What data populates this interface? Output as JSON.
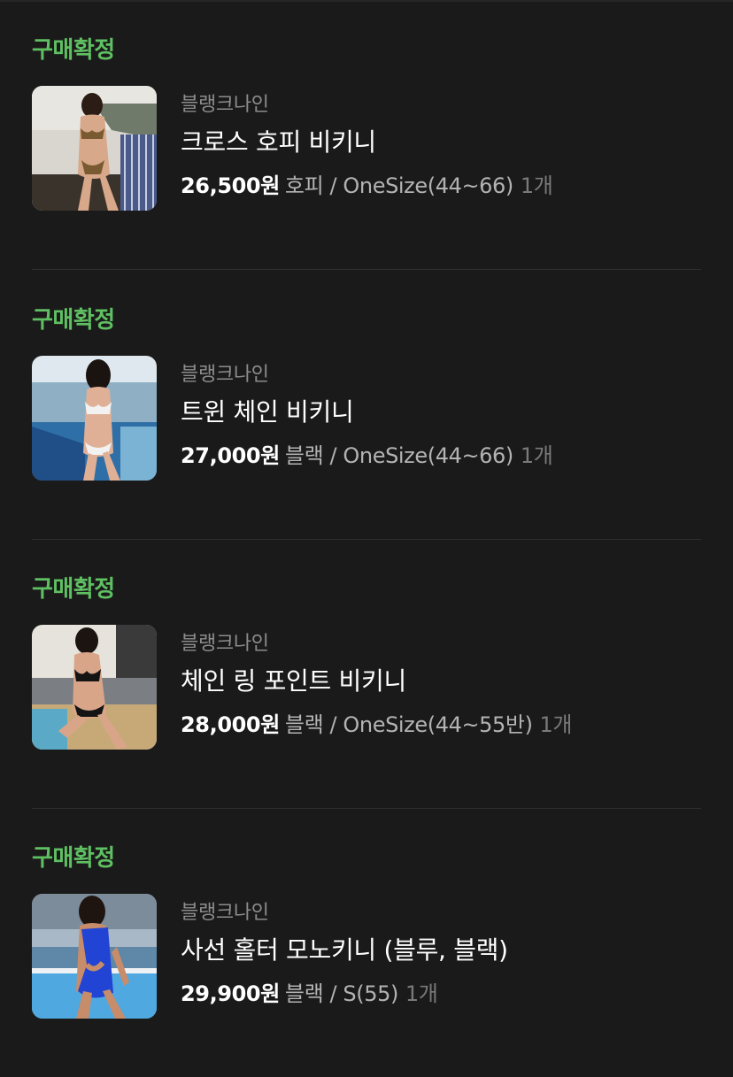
{
  "orders": [
    {
      "status": "구매확정",
      "brand": "블랭크나인",
      "title": "크로스 호피 비키니",
      "price": "26,500원",
      "option": "호피 / OneSize(44~66)",
      "quantity": "1개"
    },
    {
      "status": "구매확정",
      "brand": "블랭크나인",
      "title": "트윈 체인 비키니",
      "price": "27,000원",
      "option": "블랙 / OneSize(44~66)",
      "quantity": "1개"
    },
    {
      "status": "구매확정",
      "brand": "블랭크나인",
      "title": "체인 링 포인트 비키니",
      "price": "28,000원",
      "option": "블랙 / OneSize(44~55반)",
      "quantity": "1개"
    },
    {
      "status": "구매확정",
      "brand": "블랭크나인",
      "title": "사선 홀터 모노키니 (블루, 블랙)",
      "price": "29,900원",
      "option": "블랙 / S(55)",
      "quantity": "1개"
    }
  ],
  "colors": {
    "background": "#1a1a1a",
    "status_green": "#5fbf62",
    "brand_gray": "#8c8c8c",
    "option_gray": "#b3b3b3",
    "qty_gray": "#7a7a7a"
  }
}
